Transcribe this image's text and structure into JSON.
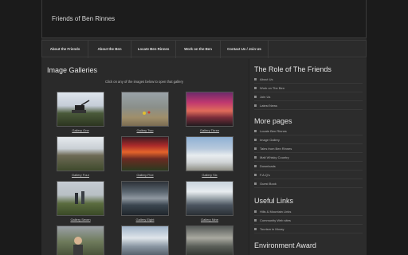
{
  "site": {
    "title": "Friends of Ben Rinnes"
  },
  "nav": [
    "About the Friends",
    "About the Ben",
    "Locate Ben Rinnes",
    "Work on the Ben",
    "Contact Us / Join Us"
  ],
  "main": {
    "title": "Image Galleries",
    "subtitle": "Click on any of the images below to open that gallery",
    "galleries": [
      "Gallery One",
      "Gallery Two",
      "Gallery Three",
      "Gallery Four",
      "Gallery Five",
      "Gallery Six",
      "Gallery Seven",
      "Gallery Eight",
      "Gallery Nine"
    ]
  },
  "sidebar": {
    "role": {
      "title": "The Role of The Friends",
      "links": [
        "About Us",
        "Work on The Ben",
        "Join Us",
        "Latest News"
      ]
    },
    "more": {
      "title": "More pages",
      "links": [
        "Locate Ben Rinnes",
        "Image Gallery",
        "Tales from Ben Rinnes",
        "Malt Whisky Country",
        "Downloads",
        "F.A.Q's",
        "Guest Book"
      ]
    },
    "useful": {
      "title": "Useful Links",
      "links": [
        "Hills & Mountain Links",
        "Community Web sites",
        "Tourism in Moray"
      ]
    },
    "env": {
      "title": "Environment Award"
    }
  },
  "colors": {
    "page_bg": "#1b1b1b",
    "panel_bg": "#2a2a2a",
    "header_bg": "#1c1c1c",
    "text": "#e4e4e4"
  }
}
